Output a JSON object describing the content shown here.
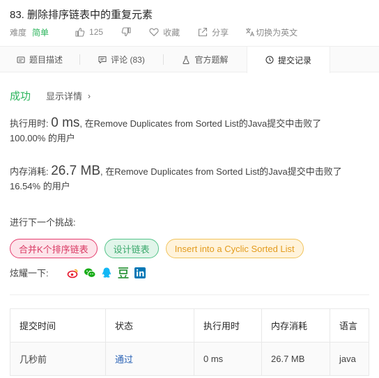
{
  "problem": {
    "title": "83. 删除排序链表中的重复元素",
    "difficulty_label": "难度",
    "difficulty_value": "简单",
    "likes": "125",
    "favorite_label": "收藏",
    "share_label": "分享",
    "switch_lang_label": "切换为英文"
  },
  "tabs": [
    {
      "label": "题目描述",
      "icon": "description-icon"
    },
    {
      "label": "评论 (83)",
      "icon": "comment-icon"
    },
    {
      "label": "官方题解",
      "icon": "flask-icon"
    },
    {
      "label": "提交记录",
      "icon": "clock-icon"
    }
  ],
  "result": {
    "status": "成功",
    "detail_label": "显示详情"
  },
  "runtime": {
    "label": "执行用时: ",
    "value": "0 ms",
    "text_a": ", 在Remove Duplicates from Sorted List的Java提交中击败了",
    "text_b": "100.00% 的用户"
  },
  "memory": {
    "label": "内存消耗: ",
    "value": "26.7 MB",
    "text_a": ", 在Remove Duplicates from Sorted List的Java提交中击败了",
    "text_b": "16.54% 的用户"
  },
  "challenge": {
    "title": "进行下一个挑战:",
    "items": [
      {
        "label": "合并K个排序链表",
        "level": "hard"
      },
      {
        "label": "设计链表",
        "level": "medium"
      },
      {
        "label": "Insert into a Cyclic Sorted List",
        "level": "easy"
      }
    ]
  },
  "share_bar": {
    "label": "炫耀一下:",
    "icons": [
      "weibo-icon",
      "wechat-icon",
      "qq-icon",
      "douban-icon",
      "linkedin-icon"
    ]
  },
  "records": {
    "headers": [
      "提交时间",
      "状态",
      "执行用时",
      "内存消耗",
      "语言"
    ],
    "rows": [
      [
        "几秒前",
        "通过",
        "0 ms",
        "26.7 MB",
        "java"
      ]
    ]
  },
  "colors": {
    "success": "#2db55d",
    "link": "#2962b5",
    "hard": "#e54070",
    "medium": "#55c48a",
    "easy": "#f1c45d"
  }
}
